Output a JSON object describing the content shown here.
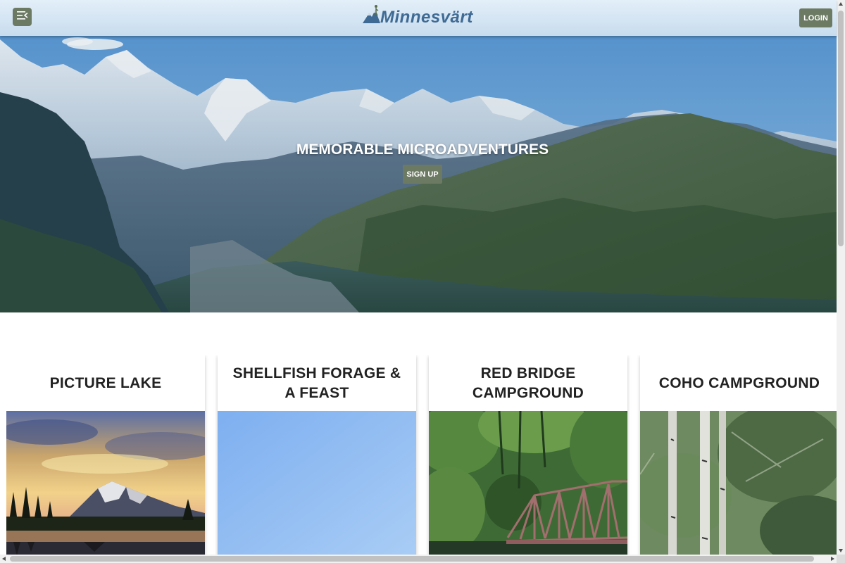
{
  "header": {
    "menu_icon": "menu-collapse-icon",
    "logo_text": "Minnesvärt",
    "logo_icon": "mountain-hiker-icon",
    "login_label": "LOGIN"
  },
  "hero": {
    "title": "MEMORABLE MICROADVENTURES",
    "signup_label": "SIGN UP",
    "image": "alpine-valley-mountains"
  },
  "cards": [
    {
      "title": "PICTURE LAKE",
      "image": "sunset-lake-mountain"
    },
    {
      "title": "SHELLFISH FORAGE & A FEAST",
      "image": "blue-sky"
    },
    {
      "title": "RED BRIDGE CAMPGROUND",
      "image": "forest-truss-bridge"
    },
    {
      "title": "COHO CAMPGROUND",
      "image": "birch-forest"
    }
  ],
  "colors": {
    "accent": "#6c7a63",
    "logo": "#3e6a94",
    "header_bg": "#d4e5f3"
  }
}
